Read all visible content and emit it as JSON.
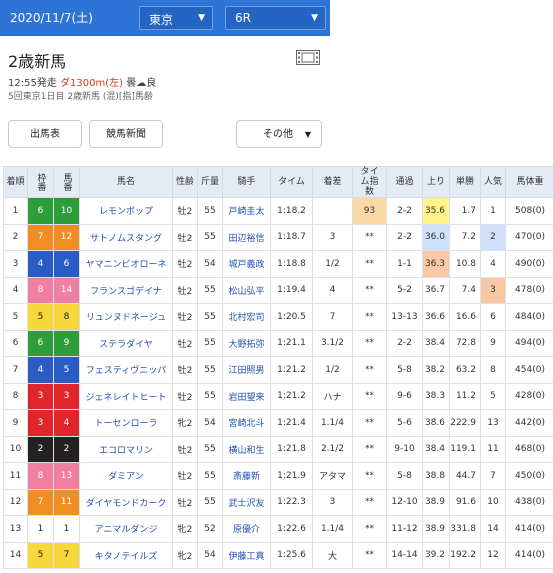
{
  "header": {
    "date": "2020/11/7(土)",
    "venue": "東京",
    "race_no": "6R"
  },
  "race": {
    "title": "2歳新馬",
    "start": "12:55発走",
    "course": "ダ1300m(左)",
    "weather_track": "曇",
    "going": "良",
    "details": "5回東京1日目 2歳新馬 (混)[指]馬齢"
  },
  "buttons": {
    "entry": "出馬表",
    "newspaper": "競馬新聞",
    "other": "その他"
  },
  "colors": {
    "header_blue": "#2e74d6",
    "rank1": "#fbd9a6",
    "yellow1": "#fff38a",
    "blue2": "#cfe0fb",
    "orange3": "#fac8a4"
  },
  "table": {
    "headers": [
      "着順",
      "枠番",
      "馬番",
      "馬名",
      "性齢",
      "斤量",
      "騎手",
      "タイム",
      "着差",
      "タイム指数",
      "通過",
      "上り",
      "単勝",
      "人気",
      "馬体重"
    ],
    "rows": [
      {
        "rank": "1",
        "waku": "6",
        "umaban": "10",
        "name": "レモンポップ",
        "sexage": "牡2",
        "weight": "55",
        "jockey": "戸崎圭太",
        "time": "1:18.2",
        "margin": "",
        "index": "93",
        "passing": "2-2",
        "last3f": "35.6",
        "odds": "1.7",
        "pop": "1",
        "body": "508(0)"
      },
      {
        "rank": "2",
        "waku": "7",
        "umaban": "12",
        "name": "サトノムスタング",
        "sexage": "牡2",
        "weight": "55",
        "jockey": "田辺裕信",
        "time": "1:18.7",
        "margin": "3",
        "index": "**",
        "passing": "2-2",
        "last3f": "36.0",
        "odds": "7.2",
        "pop": "2",
        "body": "470(0)"
      },
      {
        "rank": "3",
        "waku": "4",
        "umaban": "6",
        "name": "ヤマニンビオローネ",
        "sexage": "牡2",
        "weight": "54",
        "jockey": "城戸義政",
        "time": "1:18.8",
        "margin": "1/2",
        "index": "**",
        "passing": "1-1",
        "last3f": "36.3",
        "odds": "10.8",
        "pop": "4",
        "body": "490(0)"
      },
      {
        "rank": "4",
        "waku": "8",
        "umaban": "14",
        "name": "フランスゴデイナ",
        "sexage": "牡2",
        "weight": "55",
        "jockey": "松山弘平",
        "time": "1:19.4",
        "margin": "4",
        "index": "**",
        "passing": "5-2",
        "last3f": "36.7",
        "odds": "7.4",
        "pop": "3",
        "body": "478(0)"
      },
      {
        "rank": "5",
        "waku": "5",
        "umaban": "8",
        "name": "リュンヌドネージュ",
        "sexage": "牡2",
        "weight": "55",
        "jockey": "北村宏司",
        "time": "1:20.5",
        "margin": "7",
        "index": "**",
        "passing": "13-13",
        "last3f": "36.6",
        "odds": "16.6",
        "pop": "6",
        "body": "484(0)"
      },
      {
        "rank": "6",
        "waku": "6",
        "umaban": "9",
        "name": "ステラダイヤ",
        "sexage": "牡2",
        "weight": "55",
        "jockey": "大野拓弥",
        "time": "1:21.1",
        "margin": "3.1/2",
        "index": "**",
        "passing": "2-2",
        "last3f": "38.4",
        "odds": "72.8",
        "pop": "9",
        "body": "494(0)"
      },
      {
        "rank": "7",
        "waku": "4",
        "umaban": "5",
        "name": "フェスティヴニッパ",
        "sexage": "牡2",
        "weight": "55",
        "jockey": "江田照男",
        "time": "1:21.2",
        "margin": "1/2",
        "index": "**",
        "passing": "5-8",
        "last3f": "38.2",
        "odds": "63.2",
        "pop": "8",
        "body": "454(0)"
      },
      {
        "rank": "8",
        "waku": "3",
        "umaban": "3",
        "name": "ジェネレイトヒート",
        "sexage": "牡2",
        "weight": "55",
        "jockey": "岩田望来",
        "time": "1:21.2",
        "margin": "ハナ",
        "index": "**",
        "passing": "9-6",
        "last3f": "38.3",
        "odds": "11.2",
        "pop": "5",
        "body": "428(0)"
      },
      {
        "rank": "9",
        "waku": "3",
        "umaban": "4",
        "name": "トーセンローラ",
        "sexage": "牝2",
        "weight": "54",
        "jockey": "宮崎北斗",
        "time": "1:21.4",
        "margin": "1.1/4",
        "index": "**",
        "passing": "5-6",
        "last3f": "38.6",
        "odds": "222.9",
        "pop": "13",
        "body": "442(0)"
      },
      {
        "rank": "10",
        "waku": "2",
        "umaban": "2",
        "name": "エコロマリン",
        "sexage": "牡2",
        "weight": "55",
        "jockey": "横山和生",
        "time": "1:21.8",
        "margin": "2.1/2",
        "index": "**",
        "passing": "9-10",
        "last3f": "38.4",
        "odds": "119.1",
        "pop": "11",
        "body": "468(0)"
      },
      {
        "rank": "11",
        "waku": "8",
        "umaban": "13",
        "name": "ダミアン",
        "sexage": "牡2",
        "weight": "55",
        "jockey": "斎藤新",
        "time": "1:21.9",
        "margin": "アタマ",
        "index": "**",
        "passing": "5-8",
        "last3f": "38.8",
        "odds": "44.7",
        "pop": "7",
        "body": "450(0)"
      },
      {
        "rank": "12",
        "waku": "7",
        "umaban": "11",
        "name": "ダイヤモンドカーク",
        "sexage": "牡2",
        "weight": "55",
        "jockey": "武士沢友",
        "time": "1:22.3",
        "margin": "3",
        "index": "**",
        "passing": "12-10",
        "last3f": "38.9",
        "odds": "91.6",
        "pop": "10",
        "body": "438(0)"
      },
      {
        "rank": "13",
        "waku": "1",
        "umaban": "1",
        "name": "アニマルダンジ",
        "sexage": "牝2",
        "weight": "52",
        "jockey": "原優介",
        "time": "1:22.6",
        "margin": "1.1/4",
        "index": "**",
        "passing": "11-12",
        "last3f": "38.9",
        "odds": "331.8",
        "pop": "14",
        "body": "414(0)"
      },
      {
        "rank": "14",
        "waku": "5",
        "umaban": "7",
        "name": "キタノテイルズ",
        "sexage": "牝2",
        "weight": "54",
        "jockey": "伊藤工真",
        "time": "1:25.6",
        "margin": "大",
        "index": "**",
        "passing": "14-14",
        "last3f": "39.2",
        "odds": "192.2",
        "pop": "12",
        "body": "414(0)"
      }
    ]
  }
}
